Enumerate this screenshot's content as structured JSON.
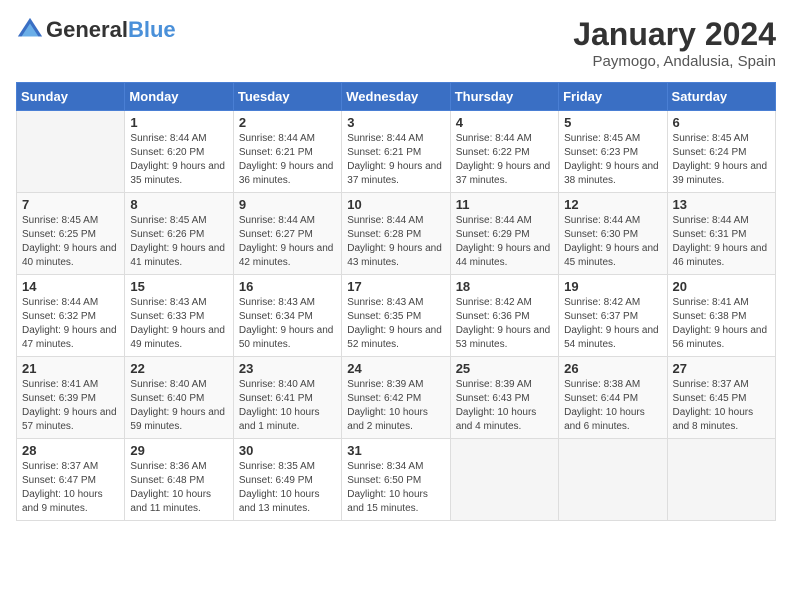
{
  "header": {
    "logo_general": "General",
    "logo_blue": "Blue",
    "month_year": "January 2024",
    "location": "Paymogo, Andalusia, Spain"
  },
  "weekdays": [
    "Sunday",
    "Monday",
    "Tuesday",
    "Wednesday",
    "Thursday",
    "Friday",
    "Saturday"
  ],
  "weeks": [
    [
      {
        "day": "",
        "sunrise": "",
        "sunset": "",
        "daylight": ""
      },
      {
        "day": "1",
        "sunrise": "Sunrise: 8:44 AM",
        "sunset": "Sunset: 6:20 PM",
        "daylight": "Daylight: 9 hours and 35 minutes."
      },
      {
        "day": "2",
        "sunrise": "Sunrise: 8:44 AM",
        "sunset": "Sunset: 6:21 PM",
        "daylight": "Daylight: 9 hours and 36 minutes."
      },
      {
        "day": "3",
        "sunrise": "Sunrise: 8:44 AM",
        "sunset": "Sunset: 6:21 PM",
        "daylight": "Daylight: 9 hours and 37 minutes."
      },
      {
        "day": "4",
        "sunrise": "Sunrise: 8:44 AM",
        "sunset": "Sunset: 6:22 PM",
        "daylight": "Daylight: 9 hours and 37 minutes."
      },
      {
        "day": "5",
        "sunrise": "Sunrise: 8:45 AM",
        "sunset": "Sunset: 6:23 PM",
        "daylight": "Daylight: 9 hours and 38 minutes."
      },
      {
        "day": "6",
        "sunrise": "Sunrise: 8:45 AM",
        "sunset": "Sunset: 6:24 PM",
        "daylight": "Daylight: 9 hours and 39 minutes."
      }
    ],
    [
      {
        "day": "7",
        "sunrise": "Sunrise: 8:45 AM",
        "sunset": "Sunset: 6:25 PM",
        "daylight": "Daylight: 9 hours and 40 minutes."
      },
      {
        "day": "8",
        "sunrise": "Sunrise: 8:45 AM",
        "sunset": "Sunset: 6:26 PM",
        "daylight": "Daylight: 9 hours and 41 minutes."
      },
      {
        "day": "9",
        "sunrise": "Sunrise: 8:44 AM",
        "sunset": "Sunset: 6:27 PM",
        "daylight": "Daylight: 9 hours and 42 minutes."
      },
      {
        "day": "10",
        "sunrise": "Sunrise: 8:44 AM",
        "sunset": "Sunset: 6:28 PM",
        "daylight": "Daylight: 9 hours and 43 minutes."
      },
      {
        "day": "11",
        "sunrise": "Sunrise: 8:44 AM",
        "sunset": "Sunset: 6:29 PM",
        "daylight": "Daylight: 9 hours and 44 minutes."
      },
      {
        "day": "12",
        "sunrise": "Sunrise: 8:44 AM",
        "sunset": "Sunset: 6:30 PM",
        "daylight": "Daylight: 9 hours and 45 minutes."
      },
      {
        "day": "13",
        "sunrise": "Sunrise: 8:44 AM",
        "sunset": "Sunset: 6:31 PM",
        "daylight": "Daylight: 9 hours and 46 minutes."
      }
    ],
    [
      {
        "day": "14",
        "sunrise": "Sunrise: 8:44 AM",
        "sunset": "Sunset: 6:32 PM",
        "daylight": "Daylight: 9 hours and 47 minutes."
      },
      {
        "day": "15",
        "sunrise": "Sunrise: 8:43 AM",
        "sunset": "Sunset: 6:33 PM",
        "daylight": "Daylight: 9 hours and 49 minutes."
      },
      {
        "day": "16",
        "sunrise": "Sunrise: 8:43 AM",
        "sunset": "Sunset: 6:34 PM",
        "daylight": "Daylight: 9 hours and 50 minutes."
      },
      {
        "day": "17",
        "sunrise": "Sunrise: 8:43 AM",
        "sunset": "Sunset: 6:35 PM",
        "daylight": "Daylight: 9 hours and 52 minutes."
      },
      {
        "day": "18",
        "sunrise": "Sunrise: 8:42 AM",
        "sunset": "Sunset: 6:36 PM",
        "daylight": "Daylight: 9 hours and 53 minutes."
      },
      {
        "day": "19",
        "sunrise": "Sunrise: 8:42 AM",
        "sunset": "Sunset: 6:37 PM",
        "daylight": "Daylight: 9 hours and 54 minutes."
      },
      {
        "day": "20",
        "sunrise": "Sunrise: 8:41 AM",
        "sunset": "Sunset: 6:38 PM",
        "daylight": "Daylight: 9 hours and 56 minutes."
      }
    ],
    [
      {
        "day": "21",
        "sunrise": "Sunrise: 8:41 AM",
        "sunset": "Sunset: 6:39 PM",
        "daylight": "Daylight: 9 hours and 57 minutes."
      },
      {
        "day": "22",
        "sunrise": "Sunrise: 8:40 AM",
        "sunset": "Sunset: 6:40 PM",
        "daylight": "Daylight: 9 hours and 59 minutes."
      },
      {
        "day": "23",
        "sunrise": "Sunrise: 8:40 AM",
        "sunset": "Sunset: 6:41 PM",
        "daylight": "Daylight: 10 hours and 1 minute."
      },
      {
        "day": "24",
        "sunrise": "Sunrise: 8:39 AM",
        "sunset": "Sunset: 6:42 PM",
        "daylight": "Daylight: 10 hours and 2 minutes."
      },
      {
        "day": "25",
        "sunrise": "Sunrise: 8:39 AM",
        "sunset": "Sunset: 6:43 PM",
        "daylight": "Daylight: 10 hours and 4 minutes."
      },
      {
        "day": "26",
        "sunrise": "Sunrise: 8:38 AM",
        "sunset": "Sunset: 6:44 PM",
        "daylight": "Daylight: 10 hours and 6 minutes."
      },
      {
        "day": "27",
        "sunrise": "Sunrise: 8:37 AM",
        "sunset": "Sunset: 6:45 PM",
        "daylight": "Daylight: 10 hours and 8 minutes."
      }
    ],
    [
      {
        "day": "28",
        "sunrise": "Sunrise: 8:37 AM",
        "sunset": "Sunset: 6:47 PM",
        "daylight": "Daylight: 10 hours and 9 minutes."
      },
      {
        "day": "29",
        "sunrise": "Sunrise: 8:36 AM",
        "sunset": "Sunset: 6:48 PM",
        "daylight": "Daylight: 10 hours and 11 minutes."
      },
      {
        "day": "30",
        "sunrise": "Sunrise: 8:35 AM",
        "sunset": "Sunset: 6:49 PM",
        "daylight": "Daylight: 10 hours and 13 minutes."
      },
      {
        "day": "31",
        "sunrise": "Sunrise: 8:34 AM",
        "sunset": "Sunset: 6:50 PM",
        "daylight": "Daylight: 10 hours and 15 minutes."
      },
      {
        "day": "",
        "sunrise": "",
        "sunset": "",
        "daylight": ""
      },
      {
        "day": "",
        "sunrise": "",
        "sunset": "",
        "daylight": ""
      },
      {
        "day": "",
        "sunrise": "",
        "sunset": "",
        "daylight": ""
      }
    ]
  ]
}
